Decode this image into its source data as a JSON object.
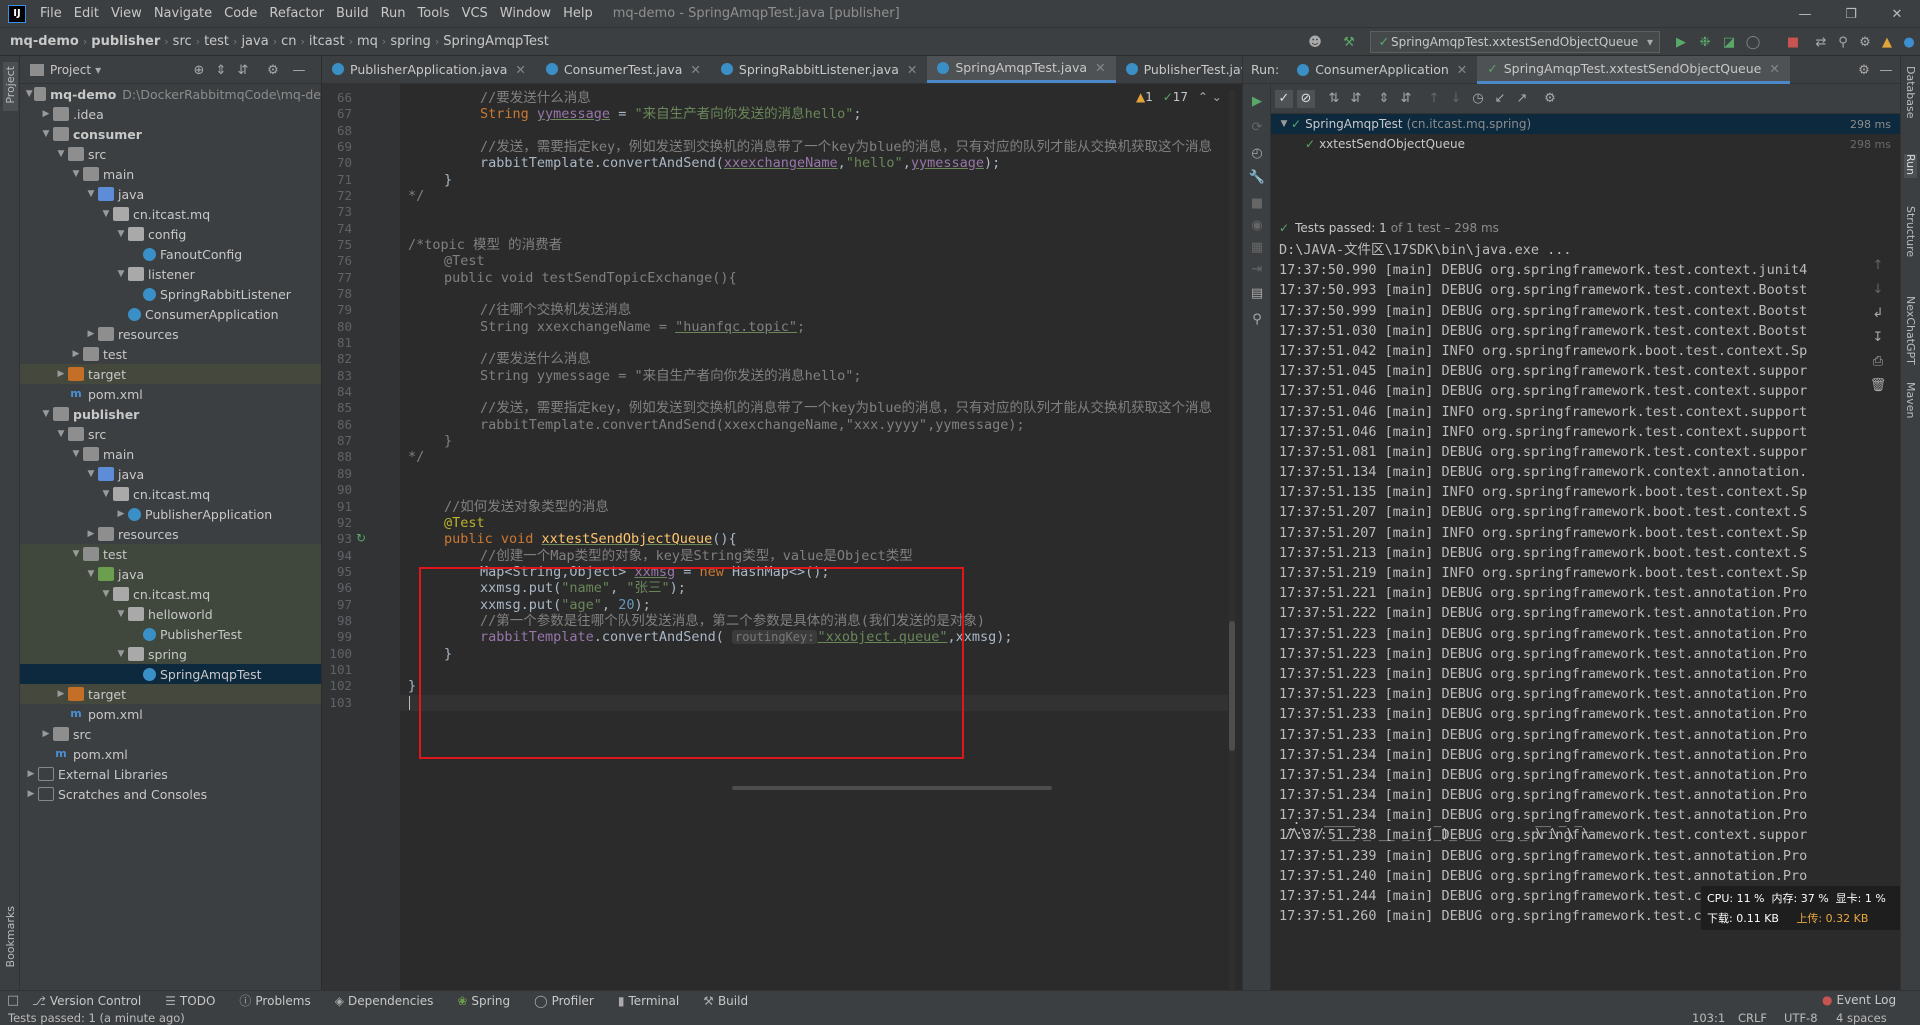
{
  "window": {
    "title": "mq-demo - SpringAmqpTest.java [publisher]",
    "menu": [
      "File",
      "Edit",
      "View",
      "Navigate",
      "Code",
      "Refactor",
      "Build",
      "Run",
      "Tools",
      "VCS",
      "Window",
      "Help"
    ]
  },
  "breadcrumb": [
    "mq-demo",
    "publisher",
    "src",
    "test",
    "java",
    "cn",
    "itcast",
    "mq",
    "spring",
    "SpringAmqpTest"
  ],
  "run_config": "SpringAmqpTest.xxtestSendObjectQueue",
  "project_panel": {
    "title": "Project",
    "tree": [
      {
        "label": "mq-demo",
        "extra": "D:\\DockerRabbitmqCode\\mq-de",
        "level": 0,
        "icon": "folder"
      },
      {
        "label": ".idea",
        "level": 1,
        "icon": "folder"
      },
      {
        "label": "consumer",
        "level": 1,
        "icon": "folder"
      },
      {
        "label": "src",
        "level": 2,
        "icon": "folder"
      },
      {
        "label": "main",
        "level": 3,
        "icon": "folder"
      },
      {
        "label": "java",
        "level": 4,
        "icon": "blue"
      },
      {
        "label": "cn.itcast.mq",
        "level": 5,
        "icon": "pkg"
      },
      {
        "label": "config",
        "level": 6,
        "icon": "pkg"
      },
      {
        "label": "FanoutConfig",
        "level": 7,
        "icon": "class"
      },
      {
        "label": "listener",
        "level": 6,
        "icon": "pkg"
      },
      {
        "label": "SpringRabbitListener",
        "level": 7,
        "icon": "class"
      },
      {
        "label": "ConsumerApplication",
        "level": 6,
        "icon": "class"
      },
      {
        "label": "resources",
        "level": 4,
        "icon": "folder"
      },
      {
        "label": "test",
        "level": 3,
        "icon": "folder"
      },
      {
        "label": "target",
        "level": 2,
        "icon": "orange"
      },
      {
        "label": "pom.xml",
        "level": 2,
        "icon": "m"
      },
      {
        "label": "publisher",
        "level": 1,
        "icon": "folder"
      },
      {
        "label": "src",
        "level": 2,
        "icon": "folder"
      },
      {
        "label": "main",
        "level": 3,
        "icon": "folder"
      },
      {
        "label": "java",
        "level": 4,
        "icon": "blue"
      },
      {
        "label": "cn.itcast.mq",
        "level": 5,
        "icon": "pkg"
      },
      {
        "label": "PublisherApplication",
        "level": 6,
        "icon": "class"
      },
      {
        "label": "resources",
        "level": 4,
        "icon": "folder"
      },
      {
        "label": "test",
        "level": 3,
        "icon": "folder"
      },
      {
        "label": "java",
        "level": 4,
        "icon": "green"
      },
      {
        "label": "cn.itcast.mq",
        "level": 5,
        "icon": "pkg"
      },
      {
        "label": "helloworld",
        "level": 6,
        "icon": "pkg"
      },
      {
        "label": "PublisherTest",
        "level": 7,
        "icon": "class"
      },
      {
        "label": "spring",
        "level": 6,
        "icon": "pkg"
      },
      {
        "label": "SpringAmqpTest",
        "level": 7,
        "icon": "class"
      },
      {
        "label": "target",
        "level": 2,
        "icon": "orange"
      },
      {
        "label": "pom.xml",
        "level": 2,
        "icon": "m"
      },
      {
        "label": "src",
        "level": 1,
        "icon": "folder"
      },
      {
        "label": "pom.xml",
        "level": 1,
        "icon": "m"
      },
      {
        "label": "External Libraries",
        "level": 0,
        "icon": "lib"
      },
      {
        "label": "Scratches and Consoles",
        "level": 0,
        "icon": "lib"
      }
    ]
  },
  "editor": {
    "tabs": [
      "PublisherApplication.java",
      "ConsumerTest.java",
      "SpringRabbitListener.java",
      "SpringAmqpTest.java",
      "PublisherTest.java"
    ],
    "active_tab": "SpringAmqpTest.java",
    "inspection": {
      "warnings": "1",
      "ok": "17"
    },
    "lines": [
      "66",
      "67",
      "68",
      "69",
      "70",
      "71",
      "72",
      "73",
      "74",
      "75",
      "76",
      "77",
      "78",
      "79",
      "80",
      "81",
      "82",
      "83",
      "84",
      "85",
      "86",
      "87",
      "88",
      "89",
      "90",
      "91",
      "92",
      "93",
      "94",
      "95",
      "96",
      "97",
      "98",
      "99",
      "100",
      "101",
      "102",
      "103"
    ],
    "code": {
      "c66": "//要发送什么消息",
      "c67a": "String ",
      "c67b": "yymessage",
      "c67c": " = ",
      "c67d": "\"来自生产者向你发送的消息hello\"",
      "c67e": ";",
      "c69": "//发送，需要指定key，例如发送到交换机的消息带了一个key为blue的消息，只有对应的队列才能从交换机获取这个消息",
      "c70a": "rabbitTemplate.convertAndSend(",
      "c70b": "xxexchangeName",
      "c70c": ",",
      "c70d": "\"hello\"",
      "c70e": ",",
      "c70f": "yymessage",
      "c70g": ");",
      "c71": "}",
      "c72": "*/",
      "c75": "/*topic 模型 的消费者",
      "c76": "@Test",
      "c77": "public void testSendTopicExchange(){",
      "c79": "//往哪个交换机发送消息",
      "c80a": "String ",
      "c80b": "xxexchangeName",
      "c80c": " = ",
      "c80d": "\"huanfqc.topic\"",
      "c80e": ";",
      "c82": "//要发送什么消息",
      "c83a": "String ",
      "c83b": "yymessage",
      "c83c": " = ",
      "c83d": "\"来自生产者向你发送的消息hello\"",
      "c83e": ";",
      "c85": "//发送，需要指定key，例如发送到交换机的消息带了一个key为blue的消息，只有对应的队列才能从交换机获取这个消息",
      "c86a": "rabbitTemplate.convertAndSend(",
      "c86b": "xxexchangeName",
      "c86c": ",",
      "c86d": "\"xxx.yyyy\"",
      "c86e": ",",
      "c86f": "yymessage",
      "c86g": ");",
      "c87": "}",
      "c88": "*/",
      "c91": "//如何发送对象类型的消息",
      "c92": "@Test",
      "c93a": "public void ",
      "c93b": "xxtestSendObjectQueue",
      "c93c": "(){",
      "c94": "//创建一个Map类型的对象，key是String类型，value是Object类型",
      "c95a": "Map<String,Object> ",
      "c95b": "xxmsg",
      "c95c": " = ",
      "c95d": "new ",
      "c95e": "HashMap<>();",
      "c96a": "xxmsg.put(",
      "c96b": "\"name\"",
      "c96c": ", ",
      "c96d": "\"张三\"",
      "c96e": ");",
      "c97a": "xxmsg.put(",
      "c97b": "\"age\"",
      "c97c": ", ",
      "c97d": "20",
      "c97e": ");",
      "c98": "//第一个参数是往哪个队列发送消息，第二个参数是具体的消息(我们发送的是对象)",
      "c99a": "rabbitTemplate",
      "c99b": ".convertAndSend( ",
      "c99hint": "routingKey:",
      "c99c": "\"xxobject.queue\"",
      "c99d": ",xxmsg);",
      "c100": "}",
      "c102": "}"
    }
  },
  "run_panel": {
    "label": "Run:",
    "tabs": [
      "ConsumerApplication",
      "SpringAmqpTest.xxtestSendObjectQueue"
    ],
    "tests": [
      {
        "name": "SpringAmqpTest",
        "pkg": "(cn.itcast.mq.spring)",
        "time": "298 ms"
      },
      {
        "name": "xxtestSendObjectQueue",
        "pkg": "",
        "time": "298 ms"
      }
    ],
    "summary": "Tests passed: 1",
    "summary_rest": "of 1 test – 298 ms",
    "console": [
      "D:\\JAVA-文件区\\17SDK\\bin\\java.exe ...",
      "17:37:50.990 [main] DEBUG org.springframework.test.context.junit4",
      "17:37:50.993 [main] DEBUG org.springframework.test.context.Bootst",
      "17:37:50.999 [main] DEBUG org.springframework.test.context.Bootst",
      "17:37:51.030 [main] DEBUG org.springframework.test.context.Bootst",
      "17:37:51.042 [main] INFO org.springframework.boot.test.context.Sp",
      "17:37:51.045 [main] DEBUG org.springframework.test.context.suppor",
      "17:37:51.046 [main] DEBUG org.springframework.test.context.suppor",
      "17:37:51.046 [main] INFO org.springframework.test.context.support",
      "17:37:51.046 [main] INFO org.springframework.test.context.support",
      "17:37:51.081 [main] DEBUG org.springframework.test.context.suppor",
      "17:37:51.134 [main] DEBUG org.springframework.context.annotation.",
      "17:37:51.135 [main] INFO org.springframework.boot.test.context.Sp",
      "17:37:51.207 [main] DEBUG org.springframework.boot.test.context.S",
      "17:37:51.207 [main] INFO org.springframework.boot.test.context.Sp",
      "17:37:51.213 [main] DEBUG org.springframework.boot.test.context.S",
      "17:37:51.219 [main] INFO org.springframework.boot.test.context.Sp",
      "17:37:51.221 [main] DEBUG org.springframework.test.annotation.Pro",
      "17:37:51.222 [main] DEBUG org.springframework.test.annotation.Pro",
      "17:37:51.223 [main] DEBUG org.springframework.test.annotation.Pro",
      "17:37:51.223 [main] DEBUG org.springframework.test.annotation.Pro",
      "17:37:51.223 [main] DEBUG org.springframework.test.annotation.Pro",
      "17:37:51.223 [main] DEBUG org.springframework.test.annotation.Pro",
      "17:37:51.233 [main] DEBUG org.springframework.test.annotation.Pro",
      "17:37:51.233 [main] DEBUG org.springframework.test.annotation.Pro",
      "17:37:51.234 [main] DEBUG org.springframework.test.annotation.Pro",
      "17:37:51.234 [main] DEBUG org.springframework.test.annotation.Pro",
      "17:37:51.234 [main] DEBUG org.springframework.test.annotation.Pro",
      "17:37:51.234 [main] DEBUG org.springframework.test.annotation.Pro",
      "17:37:51.238 [main] DEBUG org.springframework.test.context.suppor",
      "17:37:51.239 [main] DEBUG org.springframework.test.annotation.Pro",
      "17:37:51.240 [main] DEBUG org.springframework.test.annotation.Pro",
      "17:37:51.244 [main] DEBUG org.springframework.test.context.suppor",
      "17:37:51.260 [main] DEBUG org.springframework.test.context.suppor"
    ]
  },
  "sys_monitor": {
    "cpu": "CPU: 11 %",
    "mem": "内存: 37 %",
    "gpu": "显卡: 1 %",
    "down": "下载: 0.11 KB",
    "up": "上传: 0.32 KB"
  },
  "left_strip": [
    "Project",
    "Bookmarks"
  ],
  "right_strip": [
    "Database",
    "Run",
    "Structure",
    "NexChatGPT",
    "Maven"
  ],
  "bottom_tools": [
    "Version Control",
    "TODO",
    "Problems",
    "Dependencies",
    "Spring",
    "Profiler",
    "Terminal",
    "Build"
  ],
  "event_log": "Event Log",
  "status": {
    "left": "Tests passed: 1 (a minute ago)",
    "pos": "103:1",
    "eol": "CRLF",
    "enc": "UTF-8",
    "indent": "4 spaces"
  },
  "colors": {
    "accent": "#4a88c7",
    "highlight_box": "#e0161b",
    "pass": "#59a869"
  }
}
